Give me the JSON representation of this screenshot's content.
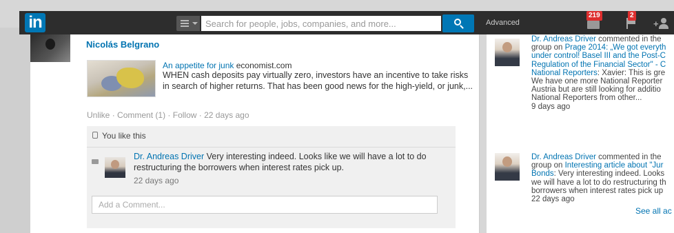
{
  "nav": {
    "logo": "in",
    "search_placeholder": "Search for people, jobs, companies, and more...",
    "advanced": "Advanced",
    "messages_count": "219",
    "notifications_count": "2",
    "add_connections": "+"
  },
  "post": {
    "actor_name": "Nicolás Belgrano",
    "share_title": "An appetite for junk",
    "share_source": "economist.com",
    "share_description": "WHEN cash deposits pay virtually zero, investors have an incentive to take risks in search of higher returns. That has been good news for the high-yield, or junk,...",
    "actions": {
      "unlike": "Unlike",
      "comment": "Comment (1)",
      "follow": "Follow",
      "time": "22 days ago"
    },
    "likes_text": "You like this",
    "comment": {
      "author": "Dr. Andreas Driver",
      "text": "Very interesting indeed. Looks like we will have a lot to do restructuring the borrowers when interest rates pick up.",
      "time": "22 days ago"
    },
    "add_comment_placeholder": "Add a Comment..."
  },
  "activity": {
    "items": [
      {
        "line1_author": "Dr. Andreas Driver",
        "line1_rest": " commented in the",
        "line2_prefix": "group on ",
        "line2_link": "Prage 2014: „We got everyth",
        "line3": "under control! Basel III and the Post-C",
        "line4": "Regulation of the Financial Sector\" - C",
        "line5_link": "National Reporters",
        "line5_rest": ": Xavier: This is gre",
        "line6": "We have one more National Reporter",
        "line7": "Austria but are still looking for additio",
        "line8": "National Reporters from other...",
        "time": "9 days ago"
      },
      {
        "line1_author": "Dr. Andreas Driver",
        "line1_rest": " commented in the",
        "line2_prefix": "group on ",
        "line2_link": "Interesting article about \"Jur",
        "line3_link": "Bonds",
        "line3_rest": ": Very interesting indeed. Looks",
        "line4": "we will have a lot to do restructuring th",
        "line5": "borrowers when interest rates pick up",
        "time": "22 days ago"
      }
    ],
    "see_all": "See all ac"
  },
  "colors": {
    "brand": "#0077b5",
    "link": "#0073b1",
    "topbar": "#2d2d2d",
    "badge": "#dd2e2e"
  }
}
